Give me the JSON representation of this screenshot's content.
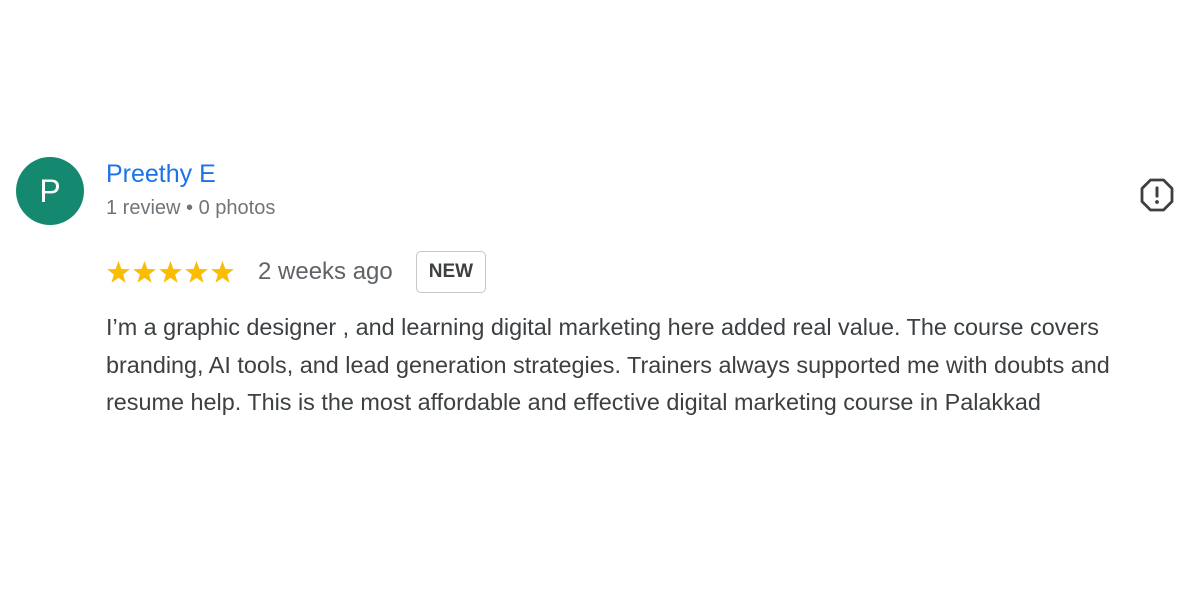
{
  "review": {
    "avatar_initial": "P",
    "reviewer_name": "Preethy E",
    "reviewer_meta": "1 review • 0 photos",
    "rating": 5,
    "rating_max": 5,
    "date": "2 weeks ago",
    "badge": "NEW",
    "text": "I’m a graphic designer , and learning digital marketing here added real value. The course covers branding, AI tools, and lead generation strategies. Trainers always supported me with doubts and resume help. This is the most affordable and effective digital marketing course in Palakkad"
  },
  "icons": {
    "report": "report-flag-icon",
    "star": "star-icon"
  },
  "colors": {
    "avatar": "#15896f",
    "name_link": "#1a73e8",
    "star": "#fbbc04"
  }
}
